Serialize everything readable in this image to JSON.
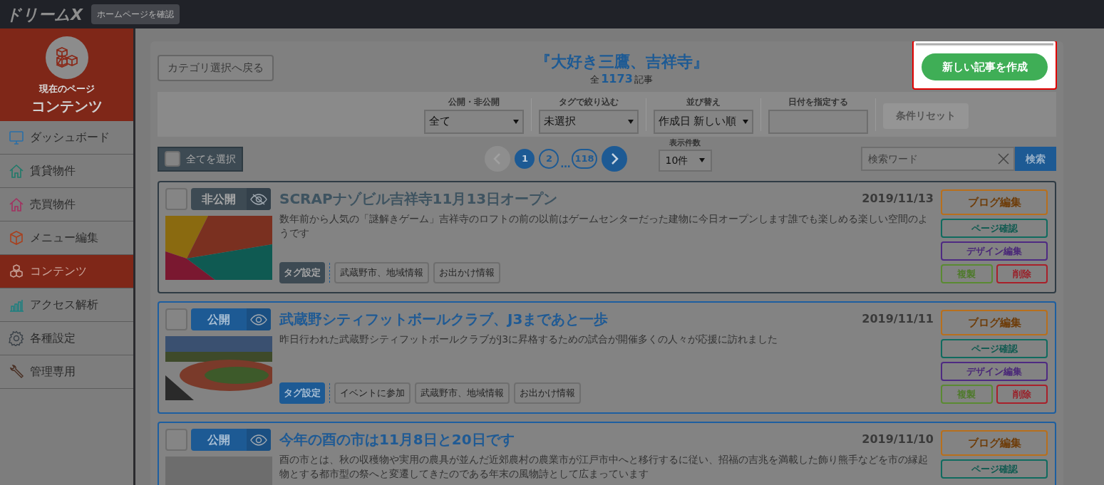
{
  "topbar": {
    "logo": "ドリームX",
    "home_button": "ホームページを確認"
  },
  "sidebar": {
    "current_caption": "現在のページ",
    "current_title": "コンテンツ",
    "items": [
      {
        "label": "ダッシュボード",
        "selected": false
      },
      {
        "label": "賃貸物件",
        "selected": false
      },
      {
        "label": "売買物件",
        "selected": false
      },
      {
        "label": "メニュー編集",
        "selected": false
      },
      {
        "label": "コンテンツ",
        "selected": true
      },
      {
        "label": "アクセス解析",
        "selected": false
      },
      {
        "label": "各種設定",
        "selected": false
      },
      {
        "label": "管理専用",
        "selected": false
      }
    ]
  },
  "header": {
    "back_button": "カテゴリ選択へ戻る",
    "title": "『大好き三鷹、吉祥寺』",
    "count_prefix": "全",
    "count": "1173",
    "count_suffix": "記事",
    "create_button": "新しい記事を作成"
  },
  "filters": {
    "fields": [
      {
        "label": "公開・非公開",
        "value": "全て",
        "kind": "select"
      },
      {
        "label": "タグで絞り込む",
        "value": "未選択",
        "kind": "select"
      },
      {
        "label": "並び替え",
        "value": "作成日 新しい順",
        "kind": "select"
      },
      {
        "label": "日付を指定する",
        "kind": "date"
      }
    ],
    "reset_button": "条件リセット"
  },
  "toolbar": {
    "select_all": {
      "label": "全てを選択",
      "checked": false
    },
    "pages": [
      {
        "label": "1",
        "selected": true
      },
      {
        "label": "2",
        "selected": false
      },
      {
        "label": "…",
        "kind": "gap",
        "selected": false
      },
      {
        "label": "118",
        "selected": false
      }
    ],
    "per_page": {
      "label": "表示件数",
      "value": "10件"
    },
    "search": {
      "placeholder": "検索ワード",
      "button": "検索"
    }
  },
  "articles": [
    {
      "checked": false,
      "status": {
        "kind": "private",
        "label": "非公開"
      },
      "title": "SCRAPナゾビル吉祥寺11月13日オープン",
      "date": "2019/11/13",
      "description": "数年前から人気の「謎解きゲーム」吉祥寺のロフトの前の以前はゲームセンターだった建物に今日オープンします誰でも楽しめる楽しい空間のようです",
      "tag_button": "タグ設定",
      "tags": [
        "武蔵野市、地域情報",
        "お出かけ情報"
      ],
      "buttons": [
        {
          "kind": "blog",
          "label": "ブログ編集"
        },
        {
          "kind": "page",
          "label": "ページ確認"
        },
        {
          "kind": "design",
          "label": "デザイン編集"
        },
        {
          "kind": "copy",
          "label": "複製"
        },
        {
          "kind": "delete",
          "label": "削除"
        }
      ]
    },
    {
      "checked": false,
      "status": {
        "kind": "public",
        "label": "公開"
      },
      "title": "武蔵野シティフットボールクラブ、J3まであと一歩",
      "date": "2019/11/11",
      "description": "昨日行われた武蔵野シティフットボールクラブがJ3に昇格するための試合が開催多くの人々が応援に訪れました",
      "tag_button": "タグ設定",
      "tags": [
        "イベントに参加",
        "武蔵野市、地域情報",
        "お出かけ情報"
      ],
      "buttons": [
        {
          "kind": "blog",
          "label": "ブログ編集"
        },
        {
          "kind": "page",
          "label": "ページ確認"
        },
        {
          "kind": "design",
          "label": "デザイン編集"
        },
        {
          "kind": "copy",
          "label": "複製"
        },
        {
          "kind": "delete",
          "label": "削除"
        }
      ]
    },
    {
      "checked": false,
      "status": {
        "kind": "public",
        "label": "公開"
      },
      "title": "今年の酉の市は11月8日と20日です",
      "date": "2019/11/10",
      "description": "酉の市とは、秋の収穫物や実用の農具が並んだ近郊農村の農業市が江戸市中へと移行するに従い、招福の吉兆を満載した飾り熊手などを市の縁起物とする都市型の祭へと変遷してきたのである年末の風物詩として広まっています",
      "buttons": [
        {
          "kind": "blog",
          "label": "ブログ編集"
        },
        {
          "kind": "page",
          "label": "ページ確認"
        }
      ]
    }
  ]
}
